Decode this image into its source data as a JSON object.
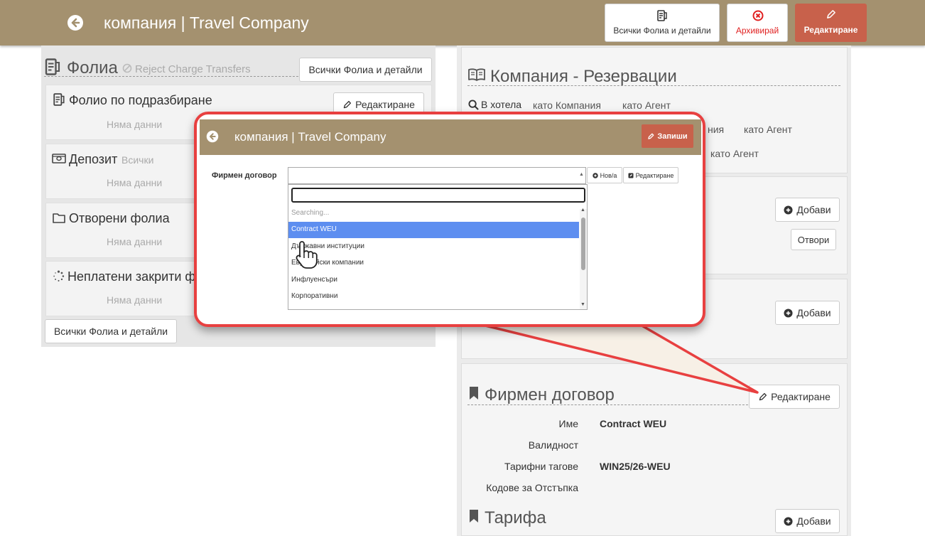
{
  "header": {
    "title": "компания | Travel Company",
    "all_folios_label": "Всички Фолиа и детайли",
    "archive_label": "Архивирай",
    "edit_label": "Редактиране"
  },
  "folios": {
    "title": "Фолиа",
    "reject_label": "Reject Charge Transfers",
    "all_folios_button": "Всички Фолиа и детайли",
    "default_folio": {
      "title": "Фолио по подразбиране",
      "edit_label": "Редактиране",
      "empty": "Няма данни"
    },
    "deposit": {
      "title": "Депозит",
      "filter": "Всички",
      "empty": "Няма данни"
    },
    "open_folios": {
      "title": "Отворени фолиа",
      "empty": "Няма данни"
    },
    "unpaid_closed": {
      "title": "Неплатени закрити ф",
      "empty": "Няма данни"
    },
    "bottom_button": "Всички Фолиа и детайли"
  },
  "reservations": {
    "title": "Компания - Резервации",
    "in_hotel": "В хотела",
    "as_company": "като Компания",
    "as_agent": "като Агент",
    "row2_partial": "ния",
    "row2_agent": "като Агент",
    "row3_agent": "като Агент",
    "add_label": "Добави",
    "open_label": "Отвори",
    "add_label_2": "Добави"
  },
  "contract": {
    "title": "Фирмен договор",
    "edit_label": "Редактиране",
    "rows": [
      {
        "label": "Име",
        "value": "Contract WEU"
      },
      {
        "label": "Валидност",
        "value": ""
      },
      {
        "label": "Тарифни тагове",
        "value": "WIN25/26-WEU"
      },
      {
        "label": "Кодове за Отстъпка",
        "value": ""
      }
    ]
  },
  "tariff": {
    "title": "Тарифа",
    "add_label": "Добави"
  },
  "popup": {
    "title": "компания | Travel Company",
    "save_label": "Запиши",
    "field_label": "Фирмен договор",
    "new_label": "Нов/а",
    "edit_label": "Редактиране",
    "search_status": "Searching...",
    "options": [
      "Contract WEU",
      "Държавни институции",
      "Европейски компании",
      "Инфлуенсъри",
      "Корпоративни"
    ],
    "selected_index": 0
  },
  "colors": {
    "header": "#a4916f",
    "danger": "#c8614b",
    "highlight": "#5d8ef0",
    "callout": "#e84040"
  }
}
